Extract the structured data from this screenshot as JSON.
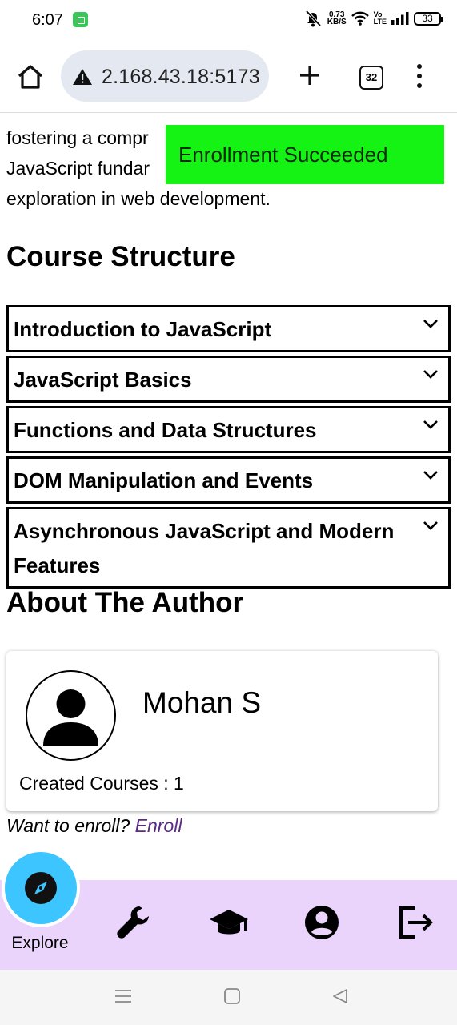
{
  "status_bar": {
    "time": "6:07",
    "net_speed_value": "0.73",
    "net_speed_unit": "KB/S",
    "volte_top": "Vo",
    "volte_bottom": "LTE",
    "battery": "33"
  },
  "browser": {
    "url": "2.168.43.18:5173",
    "tab_count": "32"
  },
  "page": {
    "intro_lines": [
      "fostering a compr",
      "JavaScript fundar",
      "exploration in web development."
    ],
    "toast": "Enrollment Succeeded",
    "toast_color": "#15f315",
    "course_structure_heading": "Course Structure",
    "modules": [
      {
        "title": "Introduction to JavaScript"
      },
      {
        "title": "JavaScript Basics"
      },
      {
        "title": "Functions and Data Structures"
      },
      {
        "title": "DOM Manipulation and Events"
      },
      {
        "title": "Asynchronous JavaScript and Modern Features"
      }
    ],
    "about_heading": "About The Author",
    "author": {
      "name": "Mohan S",
      "created_courses": "Created Courses : 1"
    },
    "enroll_prompt": "Want to enroll?",
    "enroll_link": "Enroll"
  },
  "bottom_nav": {
    "explore_label": "Explore",
    "background": "#ead4fb",
    "explore_color": "#3dc5ff",
    "items": [
      "wrench-icon",
      "graduation-cap-icon",
      "account-icon",
      "logout-icon"
    ]
  }
}
